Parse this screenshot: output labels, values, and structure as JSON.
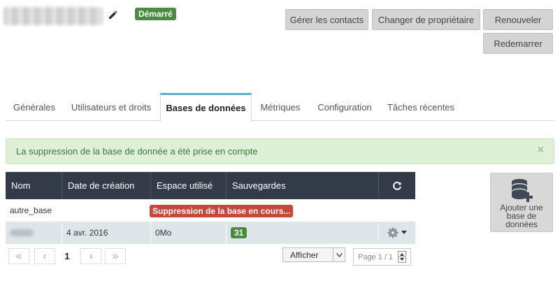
{
  "header": {
    "status_badge": "Démarré",
    "buttons": {
      "manage_contacts": "Gérer les contacts",
      "change_owner": "Changer de propriétaire",
      "renew": "Renouveler",
      "restart": "Redemarrer"
    }
  },
  "tabs": [
    {
      "label": "Générales"
    },
    {
      "label": "Utilisateurs et droits"
    },
    {
      "label": "Bases de données"
    },
    {
      "label": "Métriques"
    },
    {
      "label": "Configuration"
    },
    {
      "label": "Tâches récentes"
    }
  ],
  "active_tab": "Bases de données",
  "alert": {
    "message": "La suppression de la base de donnée a été prise en compte",
    "close": "×"
  },
  "table": {
    "columns": [
      "Nom",
      "Date de création",
      "Espace utilisé",
      "Sauvegardes"
    ],
    "rows": [
      {
        "name": "autre_base",
        "date": "",
        "space": "",
        "status": "Suppression de la base en cours..."
      },
      {
        "name": "",
        "date": "4 avr. 2016",
        "space": "0Mo",
        "backups": "31"
      }
    ]
  },
  "pagination": {
    "first": "«",
    "prev": "‹",
    "current": "1",
    "next": "›",
    "last": "»",
    "show_label": "Afficher",
    "page_info": "Page 1 / 1"
  },
  "add_database": {
    "label": "Ajouter une base de données"
  },
  "colors": {
    "accent_tab": "#5bb0cc",
    "table_header": "#333b48",
    "success_badge": "#4a8c3f",
    "danger_badge": "#c9463d",
    "alert_bg": "#dff0d8"
  },
  "icons": [
    "pencil-icon",
    "refresh-icon",
    "gear-icon",
    "caret-down-icon",
    "database-add-icon"
  ]
}
